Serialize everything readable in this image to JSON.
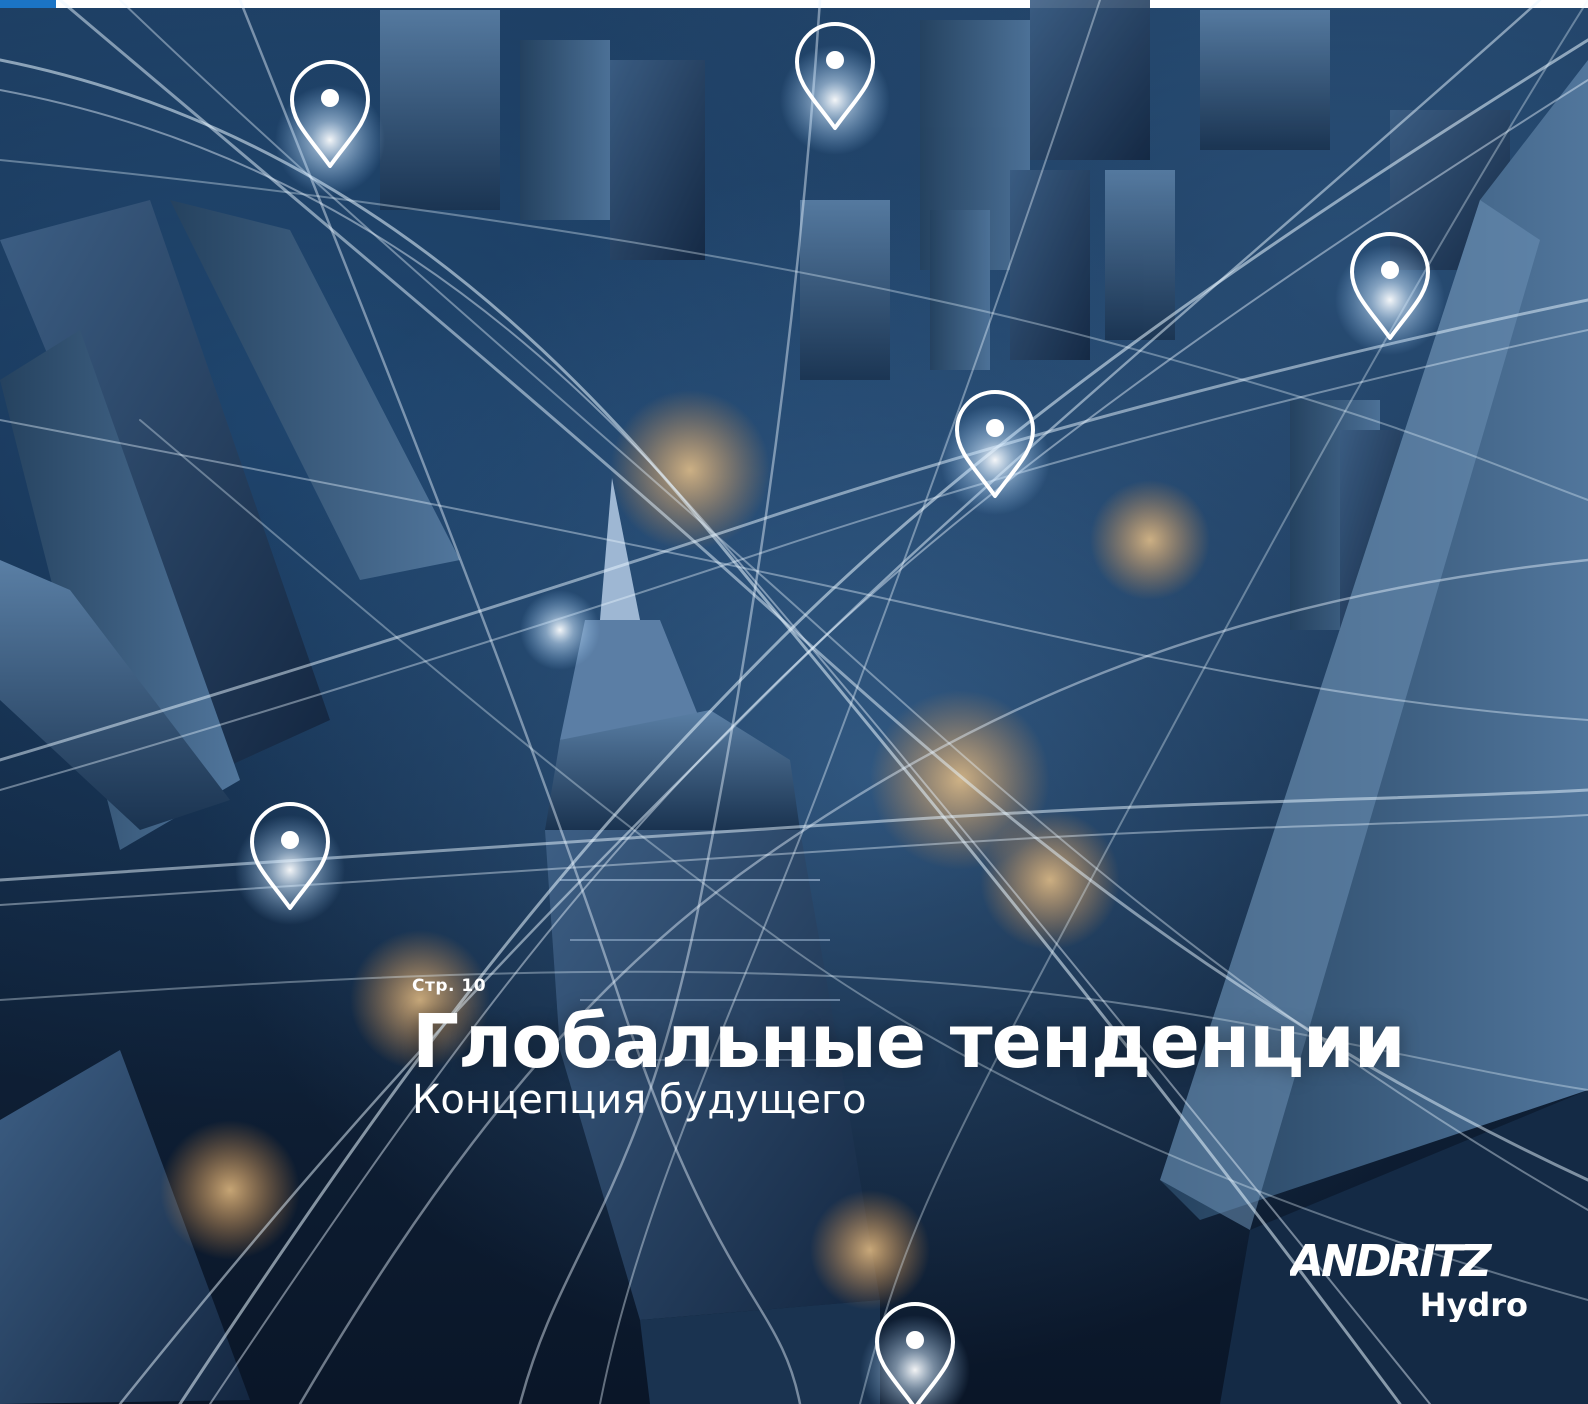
{
  "cover": {
    "page_ref": "Стр. 10",
    "title": "Глобальные тенденции",
    "subtitle": "Концепция будущего"
  },
  "brand": {
    "logo_word": "ANDRITZ",
    "logo_sub": "Hydro",
    "accent_color": "#1b74c5"
  },
  "icons": {
    "map_pin": "map-pin-icon"
  }
}
